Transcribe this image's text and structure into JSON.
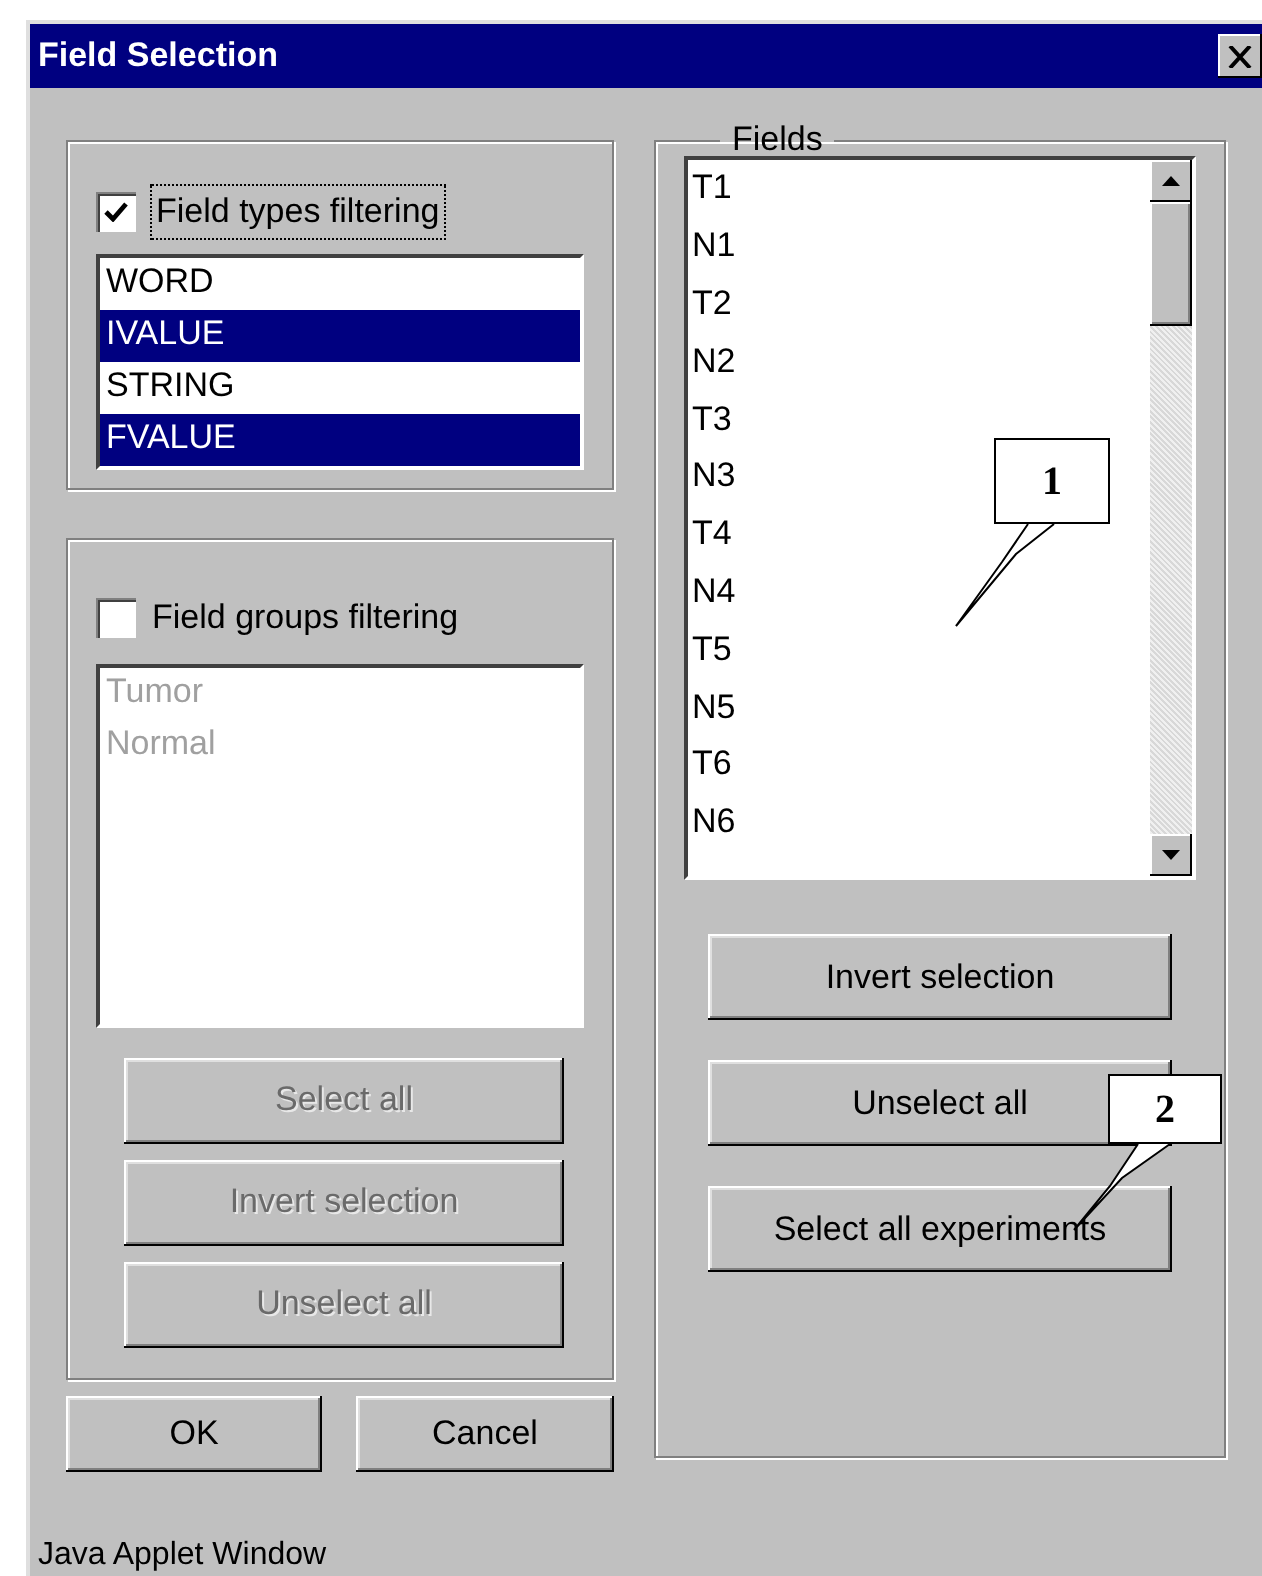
{
  "window": {
    "title": "Field Selection"
  },
  "field_types": {
    "label": "Field types filtering",
    "checked": true,
    "focused": true,
    "items": [
      {
        "label": "WORD",
        "selected": false
      },
      {
        "label": "IVALUE",
        "selected": true
      },
      {
        "label": "STRING",
        "selected": false
      },
      {
        "label": "FVALUE",
        "selected": true
      }
    ]
  },
  "field_groups": {
    "label": "Field groups filtering",
    "checked": false,
    "disabled": true,
    "items": [
      "Tumor",
      "Normal"
    ],
    "buttons": [
      {
        "label": "Select all",
        "disabled": true
      },
      {
        "label": "Invert selection",
        "disabled": true
      },
      {
        "label": "Unselect all",
        "disabled": true
      }
    ]
  },
  "fields": {
    "legend": "Fields",
    "items": [
      "T1",
      "N1",
      "T2",
      "N2",
      "T3",
      "N3",
      "T4",
      "N4",
      "T5",
      "N5",
      "T6",
      "N6"
    ],
    "buttons": [
      {
        "label": "Invert selection",
        "disabled": false
      },
      {
        "label": "Unselect all",
        "disabled": false
      },
      {
        "label": "Select all experiments",
        "disabled": false
      }
    ]
  },
  "dialog_buttons": [
    "OK",
    "Cancel"
  ],
  "callouts": [
    {
      "label": "1"
    },
    {
      "label": "2"
    }
  ],
  "status_bar": "Java Applet Window"
}
